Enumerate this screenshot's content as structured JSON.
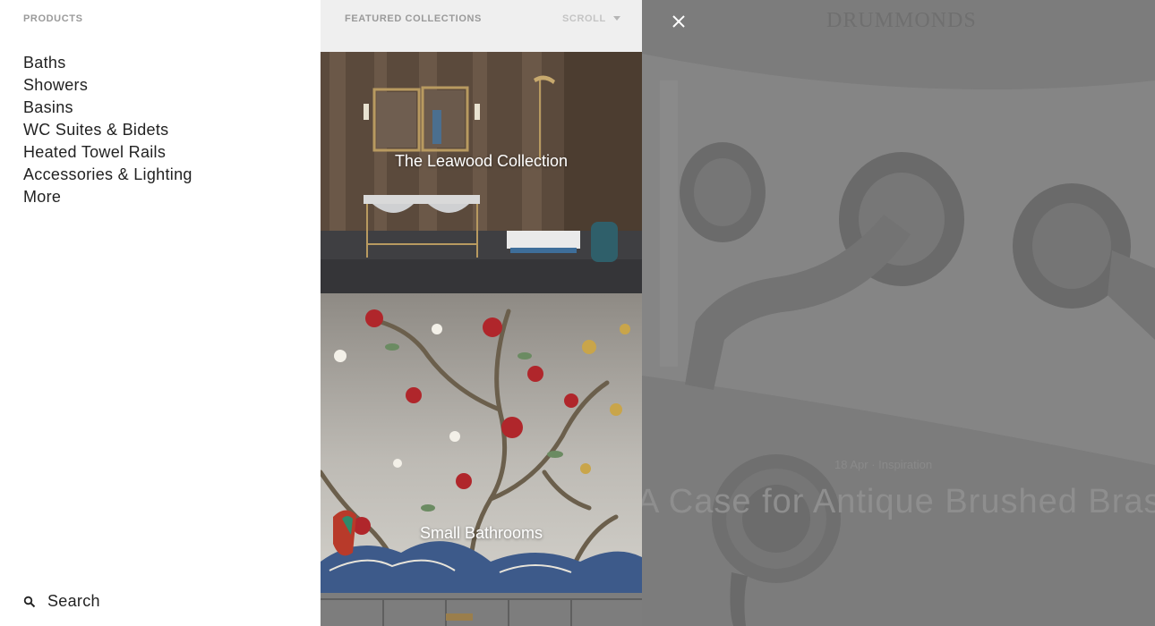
{
  "menu": {
    "heading": "PRODUCTS",
    "items": [
      {
        "label": "Baths"
      },
      {
        "label": "Showers"
      },
      {
        "label": "Basins"
      },
      {
        "label": "WC Suites & Bidets"
      },
      {
        "label": "Heated Towel Rails"
      },
      {
        "label": "Accessories & Lighting"
      },
      {
        "label": "More"
      }
    ],
    "search_label": "Search",
    "search_icon": "search-icon"
  },
  "featured": {
    "heading": "FEATURED COLLECTIONS",
    "scroll_label": "SCROLL",
    "collections": [
      {
        "title": "The Leawood Collection"
      },
      {
        "title": "Small Bathrooms"
      }
    ]
  },
  "background_page": {
    "logo": "DRUMMONDS",
    "article_meta": "18 Apr · Inspiration",
    "article_title": "A Case for Antique Brushed Brass"
  },
  "close_icon": "close-icon",
  "colors": {
    "menu_bg": "#ffffff",
    "featured_header_bg": "#efefef",
    "overlay": "#7d7d7d",
    "text_dark": "#222222",
    "heading_grey": "#9a9a9a"
  }
}
